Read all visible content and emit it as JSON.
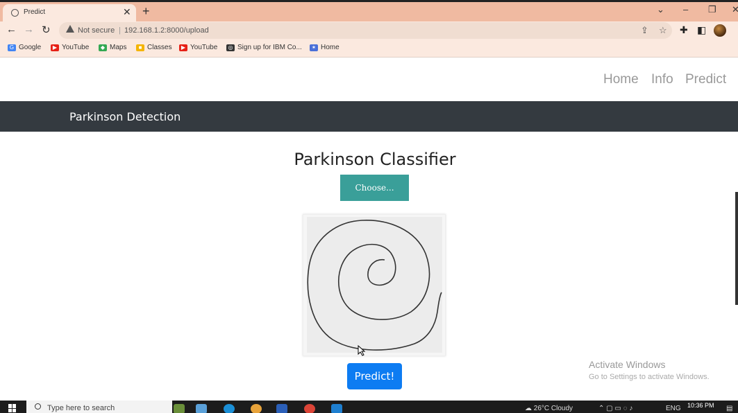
{
  "browser": {
    "tab_title": "Predict",
    "tab_close": "✕",
    "new_tab": "+",
    "address": {
      "security": "Not secure",
      "url": "192.168.1.2:8000/upload"
    },
    "bookmarks": [
      {
        "label": "Google",
        "icon": "google-icon",
        "color": "#4285f4"
      },
      {
        "label": "YouTube",
        "icon": "youtube-icon",
        "color": "#e62117"
      },
      {
        "label": "Maps",
        "icon": "maps-icon",
        "color": "#34a853"
      },
      {
        "label": "Classes",
        "icon": "classes-icon",
        "color": "#f4b400"
      },
      {
        "label": "YouTube",
        "icon": "youtube-icon",
        "color": "#e62117"
      },
      {
        "label": "Sign up for IBM Co...",
        "icon": "ibm-icon",
        "color": "#333333"
      },
      {
        "label": "Home",
        "icon": "home-icon",
        "color": "#4a6fd8"
      }
    ]
  },
  "page": {
    "nav": {
      "home": "Home",
      "info": "Info",
      "predict": "Predict"
    },
    "brand": "Parkinson Detection",
    "title": "Parkinson Classifier",
    "choose_button": "Choose...",
    "predict_button": "Predict!",
    "colors": {
      "brand_bar": "#343a40",
      "choose": "#3a9f99",
      "predict": "#0d7cf2"
    }
  },
  "watermark": {
    "line1": "Activate Windows",
    "line2": "Go to Settings to activate Windows."
  },
  "taskbar": {
    "search_placeholder": "Type here to search",
    "weather": "26°C  Cloudy",
    "language": "ENG",
    "time": "10:36 PM"
  }
}
